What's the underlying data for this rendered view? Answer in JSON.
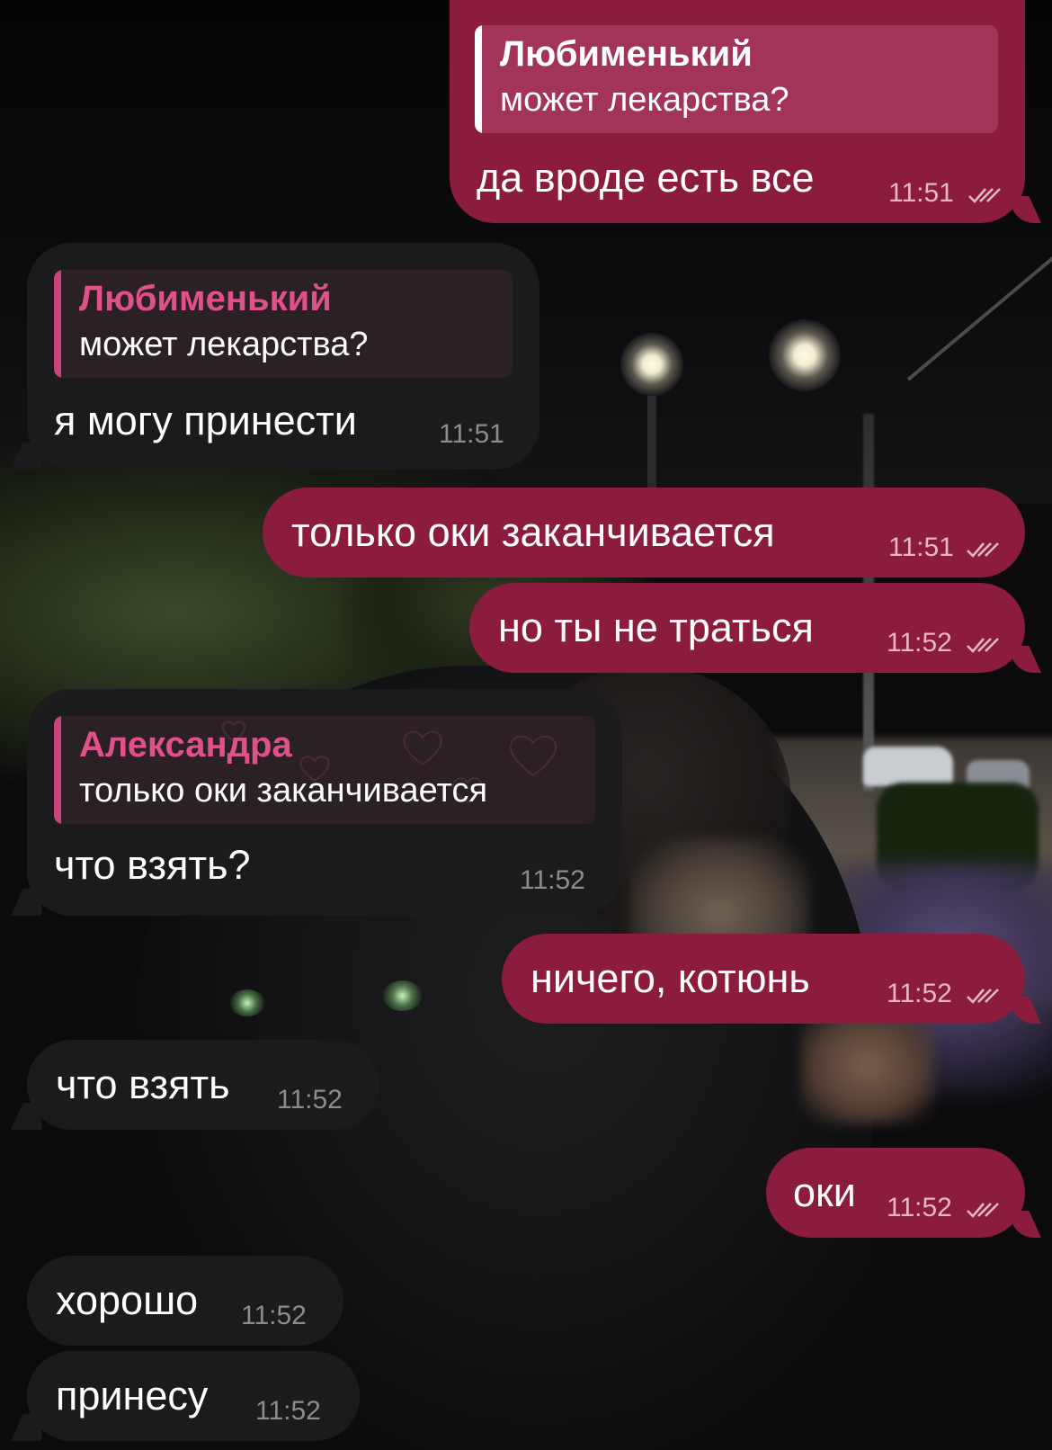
{
  "messages": [
    {
      "id": "m1",
      "direction": "out",
      "reply_to": {
        "name": "Любименький",
        "text": "может лекарства?"
      },
      "text": "да вроде есть все",
      "time": "11:51",
      "status_icon": "double-check-icon"
    },
    {
      "id": "m2",
      "direction": "in",
      "reply_to": {
        "name": "Любименький",
        "text": "может лекарства?"
      },
      "text": "я могу принести",
      "time": "11:51"
    },
    {
      "id": "m3",
      "direction": "out",
      "text": "только оки заканчивается",
      "time": "11:51",
      "status_icon": "double-check-icon"
    },
    {
      "id": "m4",
      "direction": "out",
      "text": "но ты не траться",
      "time": "11:52",
      "status_icon": "double-check-icon"
    },
    {
      "id": "m5",
      "direction": "in",
      "reply_to": {
        "name": "Александра",
        "text": "только оки заканчивается"
      },
      "text": "что взять?",
      "time": "11:52"
    },
    {
      "id": "m6",
      "direction": "out",
      "text": "ничего, котюнь",
      "time": "11:52",
      "status_icon": "double-check-icon"
    },
    {
      "id": "m7",
      "direction": "in",
      "text": "что взять",
      "time": "11:52"
    },
    {
      "id": "m8",
      "direction": "out",
      "text": "оки",
      "time": "11:52",
      "status_icon": "double-check-icon"
    },
    {
      "id": "m9",
      "direction": "in",
      "text": "хорошо",
      "time": "11:52"
    },
    {
      "id": "m10",
      "direction": "in",
      "text": "принесу",
      "time": "11:52"
    }
  ],
  "colors": {
    "outgoing_bubble": "#8b1c3e",
    "incoming_bubble": "#1b1a1c",
    "incoming_reply_name": "#e0508a",
    "outgoing_time": "#e7b7c6",
    "incoming_time": "#8e8b8f"
  }
}
